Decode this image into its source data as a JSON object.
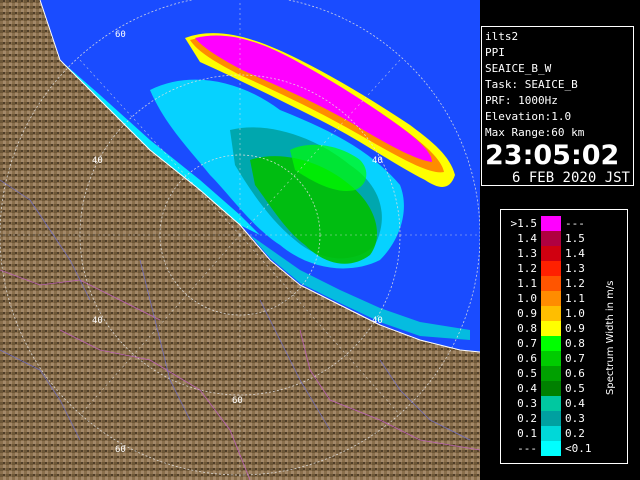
{
  "info": {
    "lines": [
      "ilts2",
      "PPI",
      "SEAICE_B_W",
      "Task: SEAICE_B",
      "PRF: 1000Hz",
      "Elevation:1.0",
      "Max Range:60 km"
    ],
    "time": "23:05:02",
    "date": "6 FEB 2020 JST"
  },
  "map": {
    "range_labels": [
      "60",
      "40",
      "40",
      "40",
      "40",
      "60",
      "60"
    ]
  },
  "legend": {
    "title": "Spectrum Width in m/s",
    "rows": [
      {
        "label": ">1.5",
        "range": "---",
        "color": "#ff00ff"
      },
      {
        "label": "1.4",
        "range": "1.5",
        "color": "#b00040"
      },
      {
        "label": "1.3",
        "range": "1.4",
        "color": "#d00010"
      },
      {
        "label": "1.2",
        "range": "1.3",
        "color": "#ff2000"
      },
      {
        "label": "1.1",
        "range": "1.2",
        "color": "#ff5500"
      },
      {
        "label": "1.0",
        "range": "1.1",
        "color": "#ff8c00"
      },
      {
        "label": "0.9",
        "range": "1.0",
        "color": "#ffbe00"
      },
      {
        "label": "0.8",
        "range": "0.9",
        "color": "#ffff00"
      },
      {
        "label": "0.7",
        "range": "0.8",
        "color": "#00ff00"
      },
      {
        "label": "0.6",
        "range": "0.7",
        "color": "#00cc00"
      },
      {
        "label": "0.5",
        "range": "0.6",
        "color": "#00a000"
      },
      {
        "label": "0.4",
        "range": "0.5",
        "color": "#008000"
      },
      {
        "label": "0.3",
        "range": "0.4",
        "color": "#00c8a0"
      },
      {
        "label": "0.2",
        "range": "0.3",
        "color": "#00a0a0"
      },
      {
        "label": "0.1",
        "range": "0.2",
        "color": "#00d8d8"
      },
      {
        "label": "---",
        "range": "<0.1",
        "color": "#00ffff"
      }
    ]
  },
  "colors": {
    "sea": "#1a4cff",
    "land": "#8a6f4c",
    "land_dark": "#5a4630",
    "rings": "#e0e0e0",
    "rivers": "#7070d0"
  }
}
